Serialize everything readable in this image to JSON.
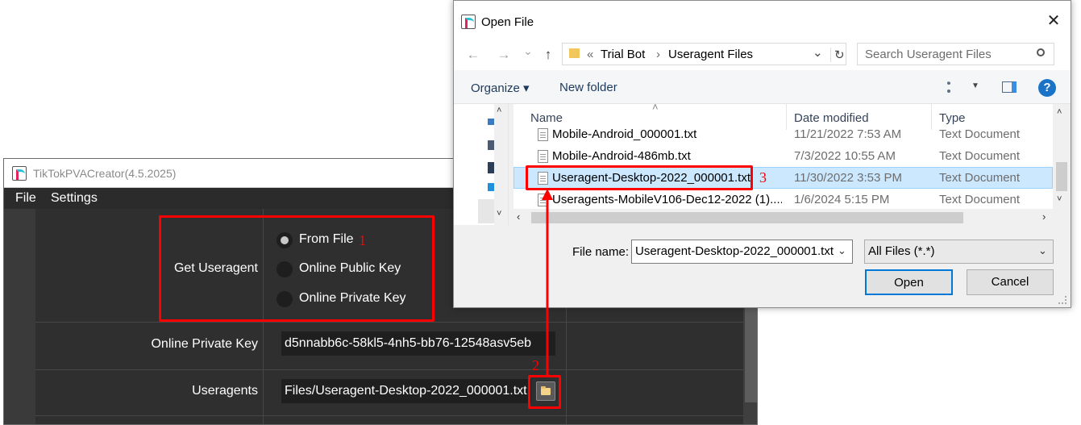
{
  "app": {
    "title": "TikTokPVACreator(4.5.2025)",
    "menu": {
      "file": "File",
      "settings": "Settings"
    },
    "get_useragent": {
      "label": "Get Useragent",
      "options": [
        "From File",
        "Online Public Key",
        "Online Private Key"
      ],
      "selected": "From File"
    },
    "online_private_key": {
      "label": "Online Private Key",
      "value": "d5nnabb6c-58kl5-4nh5-bb76-12548asv5eb"
    },
    "useragents": {
      "label": "Useragents",
      "value": "Files/Useragent-Desktop-2022_000001.txt"
    }
  },
  "annotations": {
    "n1": "1",
    "n2": "2",
    "n3": "3",
    "color": "#ff0000"
  },
  "dialog": {
    "title": "Open File",
    "close_glyph": "✕",
    "nav": {
      "back": "←",
      "forward": "→",
      "recent": "⌄",
      "up": "↑"
    },
    "breadcrumb": {
      "sep": "«",
      "parent": "Trial Bot",
      "arrow": "›",
      "current": "Useragent Files",
      "dropdown": "⌄",
      "refresh": "↻"
    },
    "search_placeholder": "Search Useragent Files",
    "toolbar": {
      "organize": "Organize ▾",
      "new_folder": "New folder",
      "help": "?"
    },
    "columns": {
      "name": "Name",
      "date": "Date modified",
      "type": "Type"
    },
    "files": [
      {
        "name": "Mobile-Android_000001.txt",
        "date": "11/21/2022 7:53 AM",
        "type": "Text Document"
      },
      {
        "name": "Mobile-Android-486mb.txt",
        "date": "7/3/2022 10:55 AM",
        "type": "Text Document"
      },
      {
        "name": "Useragent-Desktop-2022_000001.txt",
        "date": "11/30/2022 3:53 PM",
        "type": "Text Document",
        "selected": true
      },
      {
        "name": "Useragents-MobileV106-Dec12-2022 (1)....",
        "date": "1/6/2024 5:15 PM",
        "type": "Text Document"
      }
    ],
    "file_name_label": "File name:",
    "file_name_value": "Useragent-Desktop-2022_000001.txt",
    "filter_value": "All Files (*.*)",
    "open": "Open",
    "cancel": "Cancel"
  }
}
